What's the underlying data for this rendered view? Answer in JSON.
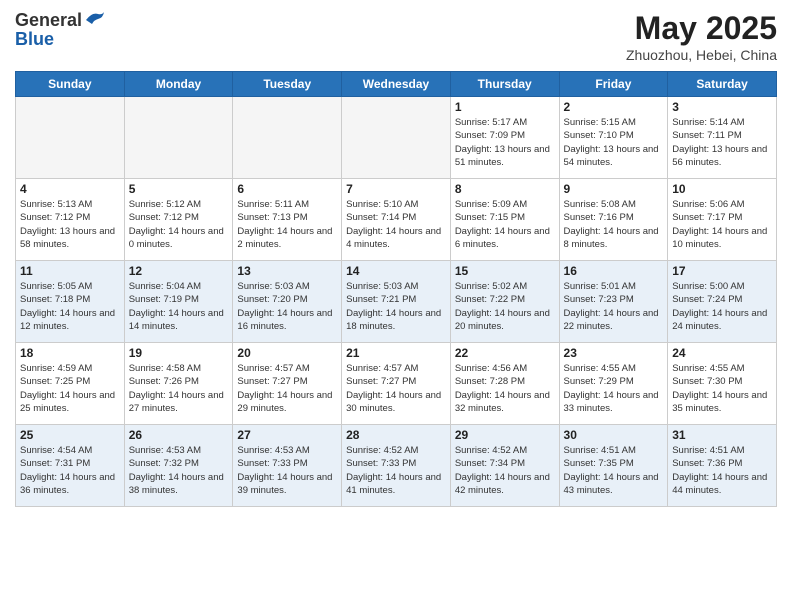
{
  "header": {
    "logo_line1": "General",
    "logo_line2": "Blue",
    "month_title": "May 2025",
    "subtitle": "Zhuozhou, Hebei, China"
  },
  "weekdays": [
    "Sunday",
    "Monday",
    "Tuesday",
    "Wednesday",
    "Thursday",
    "Friday",
    "Saturday"
  ],
  "weeks": [
    [
      {
        "day": "",
        "empty": true
      },
      {
        "day": "",
        "empty": true
      },
      {
        "day": "",
        "empty": true
      },
      {
        "day": "",
        "empty": true
      },
      {
        "day": "1",
        "sunrise": "Sunrise: 5:17 AM",
        "sunset": "Sunset: 7:09 PM",
        "daylight": "Daylight: 13 hours and 51 minutes."
      },
      {
        "day": "2",
        "sunrise": "Sunrise: 5:15 AM",
        "sunset": "Sunset: 7:10 PM",
        "daylight": "Daylight: 13 hours and 54 minutes."
      },
      {
        "day": "3",
        "sunrise": "Sunrise: 5:14 AM",
        "sunset": "Sunset: 7:11 PM",
        "daylight": "Daylight: 13 hours and 56 minutes."
      }
    ],
    [
      {
        "day": "4",
        "sunrise": "Sunrise: 5:13 AM",
        "sunset": "Sunset: 7:12 PM",
        "daylight": "Daylight: 13 hours and 58 minutes."
      },
      {
        "day": "5",
        "sunrise": "Sunrise: 5:12 AM",
        "sunset": "Sunset: 7:12 PM",
        "daylight": "Daylight: 14 hours and 0 minutes."
      },
      {
        "day": "6",
        "sunrise": "Sunrise: 5:11 AM",
        "sunset": "Sunset: 7:13 PM",
        "daylight": "Daylight: 14 hours and 2 minutes."
      },
      {
        "day": "7",
        "sunrise": "Sunrise: 5:10 AM",
        "sunset": "Sunset: 7:14 PM",
        "daylight": "Daylight: 14 hours and 4 minutes."
      },
      {
        "day": "8",
        "sunrise": "Sunrise: 5:09 AM",
        "sunset": "Sunset: 7:15 PM",
        "daylight": "Daylight: 14 hours and 6 minutes."
      },
      {
        "day": "9",
        "sunrise": "Sunrise: 5:08 AM",
        "sunset": "Sunset: 7:16 PM",
        "daylight": "Daylight: 14 hours and 8 minutes."
      },
      {
        "day": "10",
        "sunrise": "Sunrise: 5:06 AM",
        "sunset": "Sunset: 7:17 PM",
        "daylight": "Daylight: 14 hours and 10 minutes."
      }
    ],
    [
      {
        "day": "11",
        "sunrise": "Sunrise: 5:05 AM",
        "sunset": "Sunset: 7:18 PM",
        "daylight": "Daylight: 14 hours and 12 minutes."
      },
      {
        "day": "12",
        "sunrise": "Sunrise: 5:04 AM",
        "sunset": "Sunset: 7:19 PM",
        "daylight": "Daylight: 14 hours and 14 minutes."
      },
      {
        "day": "13",
        "sunrise": "Sunrise: 5:03 AM",
        "sunset": "Sunset: 7:20 PM",
        "daylight": "Daylight: 14 hours and 16 minutes."
      },
      {
        "day": "14",
        "sunrise": "Sunrise: 5:03 AM",
        "sunset": "Sunset: 7:21 PM",
        "daylight": "Daylight: 14 hours and 18 minutes."
      },
      {
        "day": "15",
        "sunrise": "Sunrise: 5:02 AM",
        "sunset": "Sunset: 7:22 PM",
        "daylight": "Daylight: 14 hours and 20 minutes."
      },
      {
        "day": "16",
        "sunrise": "Sunrise: 5:01 AM",
        "sunset": "Sunset: 7:23 PM",
        "daylight": "Daylight: 14 hours and 22 minutes."
      },
      {
        "day": "17",
        "sunrise": "Sunrise: 5:00 AM",
        "sunset": "Sunset: 7:24 PM",
        "daylight": "Daylight: 14 hours and 24 minutes."
      }
    ],
    [
      {
        "day": "18",
        "sunrise": "Sunrise: 4:59 AM",
        "sunset": "Sunset: 7:25 PM",
        "daylight": "Daylight: 14 hours and 25 minutes."
      },
      {
        "day": "19",
        "sunrise": "Sunrise: 4:58 AM",
        "sunset": "Sunset: 7:26 PM",
        "daylight": "Daylight: 14 hours and 27 minutes."
      },
      {
        "day": "20",
        "sunrise": "Sunrise: 4:57 AM",
        "sunset": "Sunset: 7:27 PM",
        "daylight": "Daylight: 14 hours and 29 minutes."
      },
      {
        "day": "21",
        "sunrise": "Sunrise: 4:57 AM",
        "sunset": "Sunset: 7:27 PM",
        "daylight": "Daylight: 14 hours and 30 minutes."
      },
      {
        "day": "22",
        "sunrise": "Sunrise: 4:56 AM",
        "sunset": "Sunset: 7:28 PM",
        "daylight": "Daylight: 14 hours and 32 minutes."
      },
      {
        "day": "23",
        "sunrise": "Sunrise: 4:55 AM",
        "sunset": "Sunset: 7:29 PM",
        "daylight": "Daylight: 14 hours and 33 minutes."
      },
      {
        "day": "24",
        "sunrise": "Sunrise: 4:55 AM",
        "sunset": "Sunset: 7:30 PM",
        "daylight": "Daylight: 14 hours and 35 minutes."
      }
    ],
    [
      {
        "day": "25",
        "sunrise": "Sunrise: 4:54 AM",
        "sunset": "Sunset: 7:31 PM",
        "daylight": "Daylight: 14 hours and 36 minutes."
      },
      {
        "day": "26",
        "sunrise": "Sunrise: 4:53 AM",
        "sunset": "Sunset: 7:32 PM",
        "daylight": "Daylight: 14 hours and 38 minutes."
      },
      {
        "day": "27",
        "sunrise": "Sunrise: 4:53 AM",
        "sunset": "Sunset: 7:33 PM",
        "daylight": "Daylight: 14 hours and 39 minutes."
      },
      {
        "day": "28",
        "sunrise": "Sunrise: 4:52 AM",
        "sunset": "Sunset: 7:33 PM",
        "daylight": "Daylight: 14 hours and 41 minutes."
      },
      {
        "day": "29",
        "sunrise": "Sunrise: 4:52 AM",
        "sunset": "Sunset: 7:34 PM",
        "daylight": "Daylight: 14 hours and 42 minutes."
      },
      {
        "day": "30",
        "sunrise": "Sunrise: 4:51 AM",
        "sunset": "Sunset: 7:35 PM",
        "daylight": "Daylight: 14 hours and 43 minutes."
      },
      {
        "day": "31",
        "sunrise": "Sunrise: 4:51 AM",
        "sunset": "Sunset: 7:36 PM",
        "daylight": "Daylight: 14 hours and 44 minutes."
      }
    ]
  ]
}
